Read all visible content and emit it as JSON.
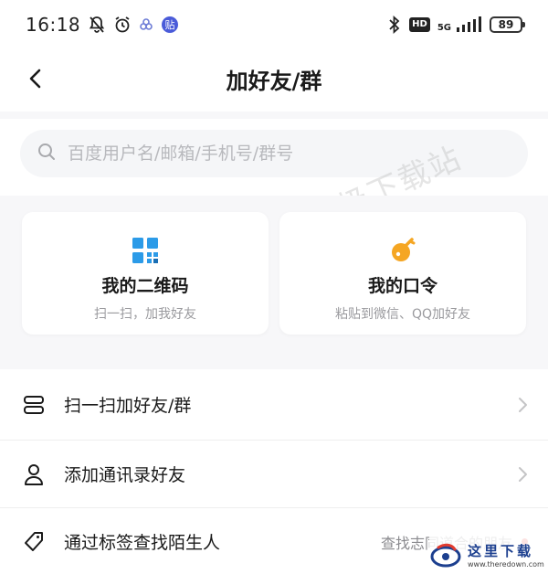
{
  "status_bar": {
    "time": "16:18",
    "app_badge": "贴",
    "hd": "HD",
    "network": "5G",
    "battery": "89"
  },
  "nav": {
    "title": "加好友/群"
  },
  "search": {
    "placeholder": "百度用户名/邮箱/手机号/群号"
  },
  "watermark": "天极下载站",
  "cards": [
    {
      "title": "我的二维码",
      "subtitle": "扫一扫，加我好友",
      "icon": "qr-code-icon",
      "color": "#2c9be8"
    },
    {
      "title": "我的口令",
      "subtitle": "粘贴到微信、QQ加好友",
      "icon": "command-icon",
      "color": "#f5a623"
    }
  ],
  "list": [
    {
      "label": "扫一扫加好友/群",
      "icon": "scan-icon"
    },
    {
      "label": "添加通讯录好友",
      "icon": "contact-icon"
    },
    {
      "label": "通过标签查找陌生人",
      "icon": "tag-icon",
      "hint": "查找志同道合的朋友"
    }
  ],
  "site_logo": {
    "cn": "这里下载",
    "en": "www.theredown.com"
  }
}
